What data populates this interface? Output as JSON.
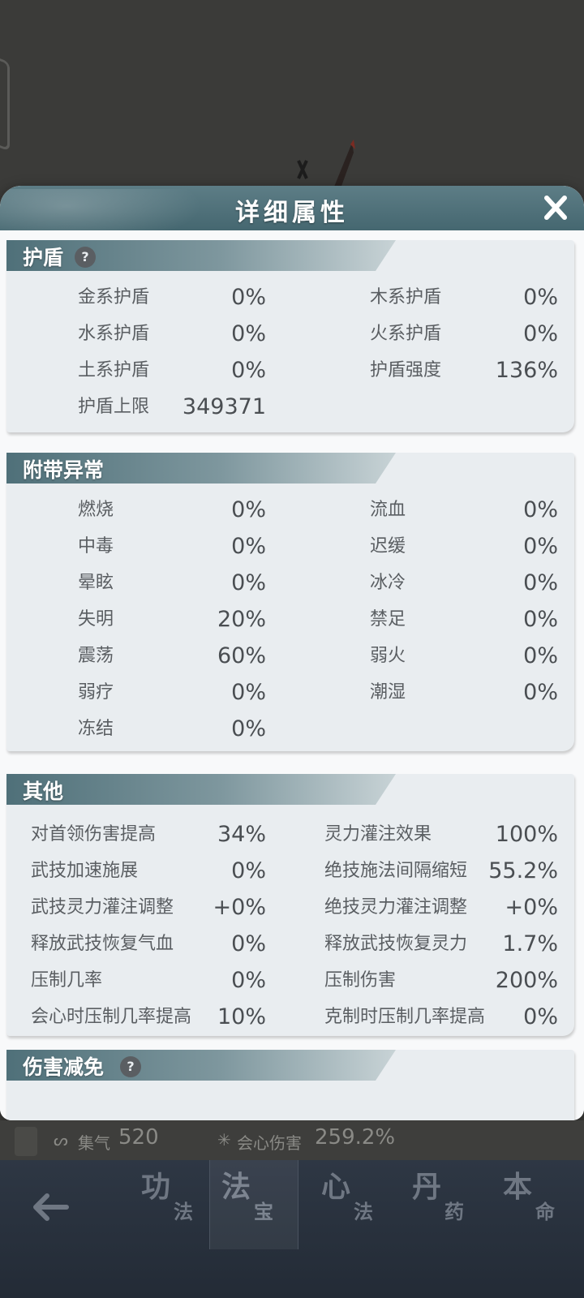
{
  "modal": {
    "title": "详细属性",
    "close_icon": "close-icon"
  },
  "shield": {
    "title": "护盾",
    "help_icon": "?",
    "rows": [
      {
        "label": "金系护盾",
        "value": "0%"
      },
      {
        "label": "木系护盾",
        "value": "0%"
      },
      {
        "label": "水系护盾",
        "value": "0%"
      },
      {
        "label": "火系护盾",
        "value": "0%"
      },
      {
        "label": "土系护盾",
        "value": "0%"
      },
      {
        "label": "护盾强度",
        "value": "136%"
      },
      {
        "label": "护盾上限",
        "value": "349371"
      }
    ]
  },
  "abnormal": {
    "title": "附带异常",
    "rows": [
      {
        "label": "燃烧",
        "value": "0%"
      },
      {
        "label": "流血",
        "value": "0%"
      },
      {
        "label": "中毒",
        "value": "0%"
      },
      {
        "label": "迟缓",
        "value": "0%"
      },
      {
        "label": "晕眩",
        "value": "0%"
      },
      {
        "label": "冰冷",
        "value": "0%"
      },
      {
        "label": "失明",
        "value": "20%"
      },
      {
        "label": "禁足",
        "value": "0%"
      },
      {
        "label": "震荡",
        "value": "60%"
      },
      {
        "label": "弱火",
        "value": "0%"
      },
      {
        "label": "弱疗",
        "value": "0%"
      },
      {
        "label": "潮湿",
        "value": "0%"
      },
      {
        "label": "冻结",
        "value": "0%"
      }
    ]
  },
  "other": {
    "title": "其他",
    "rows": [
      {
        "label": "对首领伤害提高",
        "value": "34%"
      },
      {
        "label": "灵力灌注效果",
        "value": "100%"
      },
      {
        "label": "武技加速施展",
        "value": "0%"
      },
      {
        "label": "绝技施法间隔缩短",
        "value": "55.2%"
      },
      {
        "label": "武技灵力灌注调整",
        "value": "+0%"
      },
      {
        "label": "绝技灵力灌注调整",
        "value": "+0%"
      },
      {
        "label": "释放武技恢复气血",
        "value": "0%"
      },
      {
        "label": "释放武技恢复灵力",
        "value": "1.7%"
      },
      {
        "label": "压制几率",
        "value": "0%"
      },
      {
        "label": "压制伤害",
        "value": "200%"
      },
      {
        "label": "会心时压制几率提高",
        "value": "10%"
      },
      {
        "label": "克制时压制几率提高",
        "value": "0%"
      }
    ]
  },
  "damage_reduction": {
    "title": "伤害减免",
    "help_icon": "?"
  },
  "stats_strip": {
    "gather_label": "集气",
    "gather_value": "520",
    "crit_label": "会心伤害",
    "crit_value": "259.2%"
  },
  "bottom_nav": {
    "back_icon": "back-arrow-icon",
    "tabs": [
      {
        "main": "功",
        "sub": "法"
      },
      {
        "main": "法",
        "sub": "宝"
      },
      {
        "main": "心",
        "sub": "法"
      },
      {
        "main": "丹",
        "sub": "药"
      },
      {
        "main": "本",
        "sub": "命"
      }
    ]
  },
  "colors": {
    "header": "#456770",
    "section_bg": "#e9edf0",
    "page_bg": "#3b3b39"
  }
}
